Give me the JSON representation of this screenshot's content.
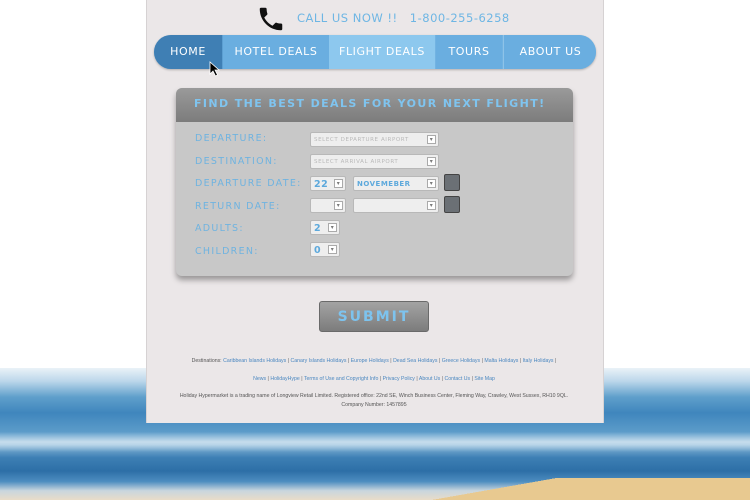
{
  "header": {
    "call_text": "CALL US NOW !!",
    "phone_number": "1-800-255-6258"
  },
  "nav": {
    "items": [
      {
        "label": "HOME"
      },
      {
        "label": "HOTEL DEALS"
      },
      {
        "label": "FLIGHT DEALS"
      },
      {
        "label": "TOURS"
      },
      {
        "label": "ABOUT US"
      }
    ]
  },
  "form": {
    "title": "FIND THE BEST DEALS FOR YOUR NEXT FLIGHT!",
    "departure_label": "DEPARTURE:",
    "departure_value": "SELECT DEPARTURE AIRPORT",
    "destination_label": "DESTINATION:",
    "destination_value": "SELECT ARRIVAL AIRPORT",
    "departure_date_label": "DEPARTURE DATE:",
    "departure_day": "22",
    "departure_month": "NOVEMEBER",
    "return_date_label": "RETURN DATE:",
    "return_day": "",
    "return_month": "",
    "adults_label": "ADULTS:",
    "adults_value": "2",
    "children_label": "CHILDREN:",
    "children_value": "0"
  },
  "submit_label": "SUBMIT",
  "footer": {
    "destinations_prefix": "Destinations:",
    "destinations": [
      "Caribbean Islands Holidays",
      "Canary Islands Holidays",
      "Europe Holidays",
      "Dead Sea Holidays",
      "Greece Holidays",
      "Malta Holidays",
      "Italy Holidays"
    ],
    "links": [
      "News",
      "HolidayHype",
      "Terms of Use and Copyright Info",
      "Privacy Policy",
      "About Us",
      "Contact Us",
      "Site Map"
    ],
    "legal_line1": "Holiday Hypermarket is a trading name of Longview Retail Limited. Registered office: 22nd SE, Winch Business Center, Fleming Way, Crawley, West Sussex, RH10 9QL.",
    "legal_line2": "Company Number: 1457895"
  },
  "icons": {
    "phone": "phone-icon",
    "cursor": "mouse-cursor-icon",
    "calendar": "calendar-icon",
    "dropdown": "chevron-down-icon"
  },
  "colors": {
    "accent": "#6eb6e4",
    "nav_active": "#3f7fb4",
    "nav_highlight": "#8dc8ee"
  }
}
